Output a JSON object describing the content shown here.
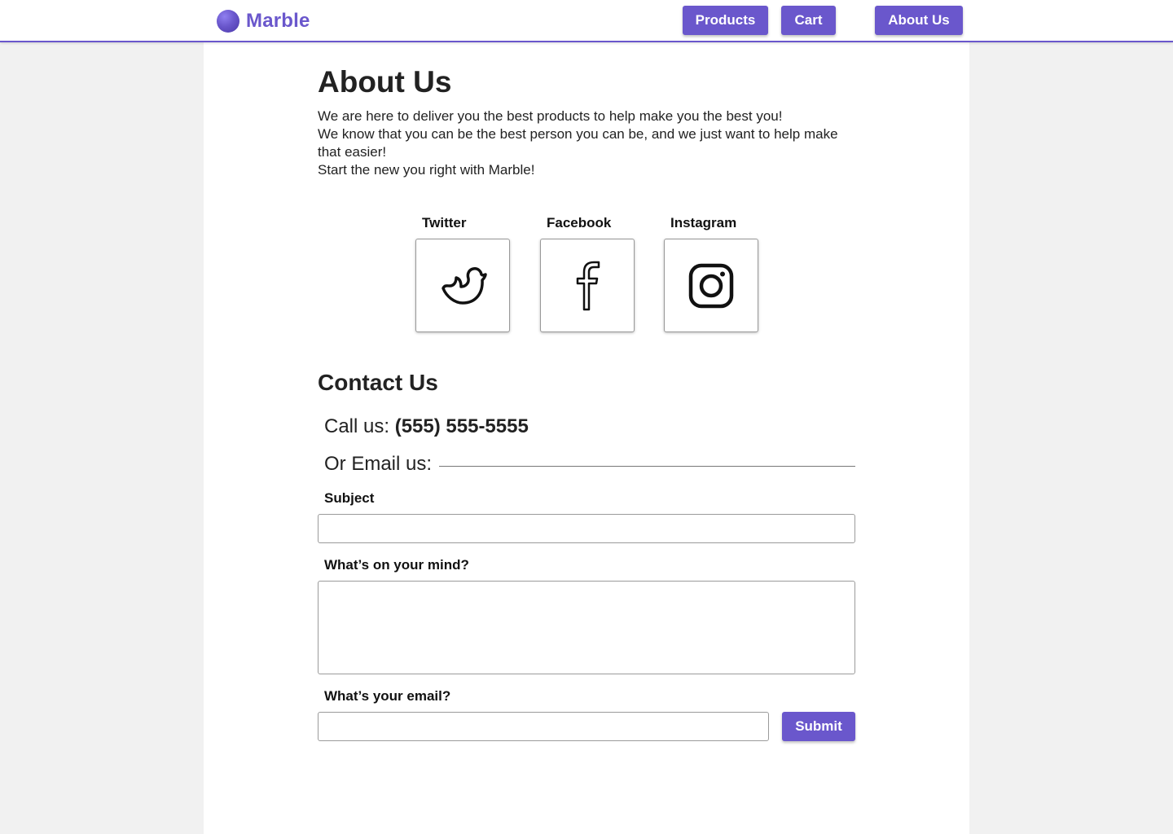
{
  "brand": {
    "name": "Marble",
    "accent": "#6a57cc"
  },
  "nav": {
    "products": "Products",
    "cart": "Cart",
    "about": "About Us"
  },
  "about": {
    "title": "About Us",
    "lines": [
      "We are here to deliver you the best products to help make you the best you!",
      "We know that you can be the best person you can be, and we just want to help make that easier!",
      "Start the new you right with Marble!"
    ]
  },
  "social": [
    {
      "label": "Twitter",
      "icon": "twitter-bird-icon"
    },
    {
      "label": "Facebook",
      "icon": "facebook-f-icon"
    },
    {
      "label": "Instagram",
      "icon": "instagram-camera-icon"
    }
  ],
  "contact": {
    "title": "Contact Us",
    "call_prefix": "Call us:",
    "phone": "(555) 555-5555",
    "email_prompt": "Or Email us:",
    "subject_label": "Subject",
    "subject_value": "",
    "mind_label": "What’s on your mind?",
    "mind_value": "",
    "email_label": "What’s your email?",
    "email_value": "",
    "submit": "Submit"
  }
}
